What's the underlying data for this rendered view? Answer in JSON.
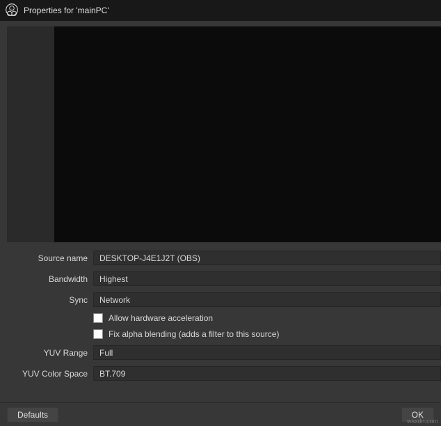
{
  "titlebar": {
    "title": "Properties for 'mainPC'"
  },
  "form": {
    "source_name": {
      "label": "Source name",
      "value": "DESKTOP-J4E1J2T (OBS)"
    },
    "bandwidth": {
      "label": "Bandwidth",
      "value": "Highest"
    },
    "sync": {
      "label": "Sync",
      "value": "Network"
    },
    "hardware_accel": {
      "label": "Allow hardware acceleration",
      "checked": false
    },
    "alpha_blending": {
      "label": "Fix alpha blending (adds a filter to this source)",
      "checked": false
    },
    "yuv_range": {
      "label": "YUV Range",
      "value": "Full"
    },
    "yuv_color_space": {
      "label": "YUV Color Space",
      "value": "BT.709"
    }
  },
  "footer": {
    "defaults": "Defaults",
    "ok": "OK"
  },
  "watermark": "wsxdn.com"
}
